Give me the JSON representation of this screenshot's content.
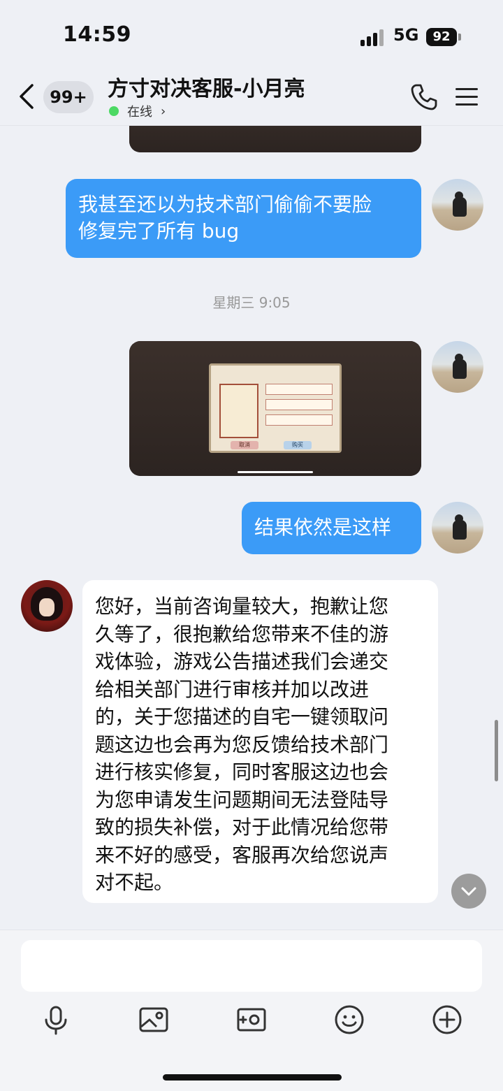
{
  "status_bar": {
    "time": "14:59",
    "network": "5G",
    "battery": "92"
  },
  "header": {
    "unread_count": "99+",
    "title": "方寸对决客服-小月亮",
    "presence": "在线"
  },
  "messages": [
    {
      "id": "m1",
      "from": "self",
      "type": "text",
      "lines": [
        "我甚至还以为技术部门偷偷不要脸",
        "修复完了所有 bug"
      ]
    },
    {
      "id": "sep1",
      "type": "time",
      "text": "星期三 9:05"
    },
    {
      "id": "m2",
      "from": "self",
      "type": "image",
      "image_desc": "game-screenshot",
      "game_labels": {
        "cancel": "取消",
        "buy": "购买"
      }
    },
    {
      "id": "m3",
      "from": "self",
      "type": "text",
      "lines": [
        "结果依然是这样"
      ]
    },
    {
      "id": "m4",
      "from": "agent",
      "type": "text",
      "lines": [
        "您好，当前咨询量较大，抱歉让您",
        "久等了，很抱歉给您带来不佳的游",
        "戏体验，游戏公告描述我们会递交",
        "给相关部门进行审核并加以改进",
        "的，关于您描述的自宅一键领取问",
        "题这边也会再为您反馈给技术部门",
        "进行核实修复，同时客服这边也会",
        "为您申请发生问题期间无法登陆导",
        "致的损失补偿，对于此情况给您带",
        "来不好的感受，客服再次给您说声",
        "对不起。"
      ]
    }
  ],
  "composer": {
    "tools": [
      {
        "name": "mic-icon"
      },
      {
        "name": "image-icon"
      },
      {
        "name": "camera-icon"
      },
      {
        "name": "emoji-icon"
      },
      {
        "name": "plus-icon"
      }
    ]
  },
  "colors": {
    "outgoing_bubble": "#3b9bf7",
    "incoming_bubble": "#ffffff",
    "background": "#eef0f5",
    "online_dot": "#4cd964"
  }
}
